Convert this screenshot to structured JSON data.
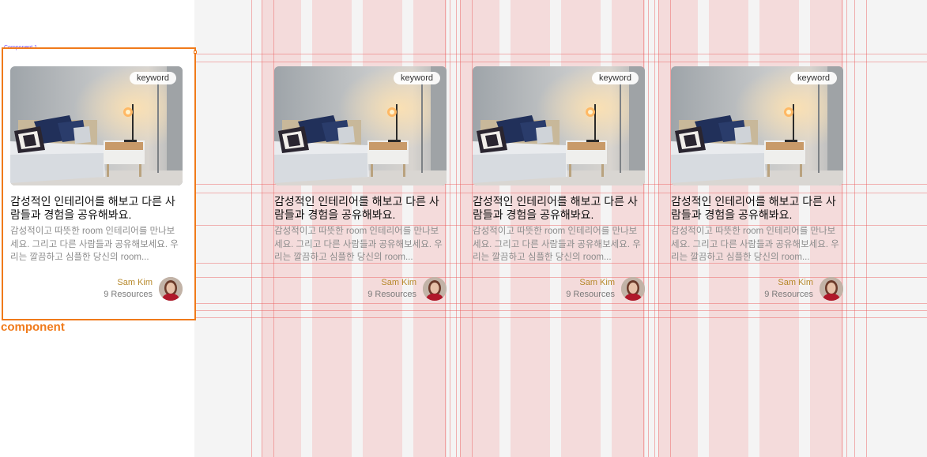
{
  "frame": {
    "tag": "Component 1",
    "label": "component"
  },
  "cards": [
    {
      "keyword": "keyword",
      "title": "감성적인 인테리어를 해보고 다른 사람들과 경험을 공유해봐요.",
      "description": "감성적이고 따뜻한 room 인테리어를 만나보세요. 그리고 다른 사람들과 공유해보세요. 우리는 깔끔하고 심플한 당신의 room...",
      "author": "Sam Kim",
      "resources": "9 Resources"
    },
    {
      "keyword": "keyword",
      "title": "감성적인 인테리어를 해보고 다른 사람들과 경험을 공유해봐요.",
      "description": "감성적이고 따뜻한 room 인테리어를 만나보세요. 그리고 다른 사람들과 공유해보세요. 우리는 깔끔하고 심플한 당신의 room...",
      "author": "Sam Kim",
      "resources": "9 Resources"
    },
    {
      "keyword": "keyword",
      "title": "감성적인 인테리어를 해보고 다른 사람들과 경험을 공유해봐요.",
      "description": "감성적이고 따뜻한 room 인테리어를 만나보세요. 그리고 다른 사람들과 공유해보세요. 우리는 깔끔하고 심플한 당신의 room...",
      "author": "Sam Kim",
      "resources": "9 Resources"
    },
    {
      "keyword": "keyword",
      "title": "감성적인 인테리어를 해보고 다른 사람들과 경험을 공유해봐요.",
      "description": "감성적이고 따뜻한 room 인테리어를 만나보세요. 그리고 다른 사람들과 공유해보세요. 우리는 깔끔하고 심플한 당신의 room...",
      "author": "Sam Kim",
      "resources": "9 Resources"
    }
  ],
  "colors": {
    "frame_accent": "#f07a1a",
    "author": "#b7892b",
    "grid_overlay": "#f48282"
  }
}
